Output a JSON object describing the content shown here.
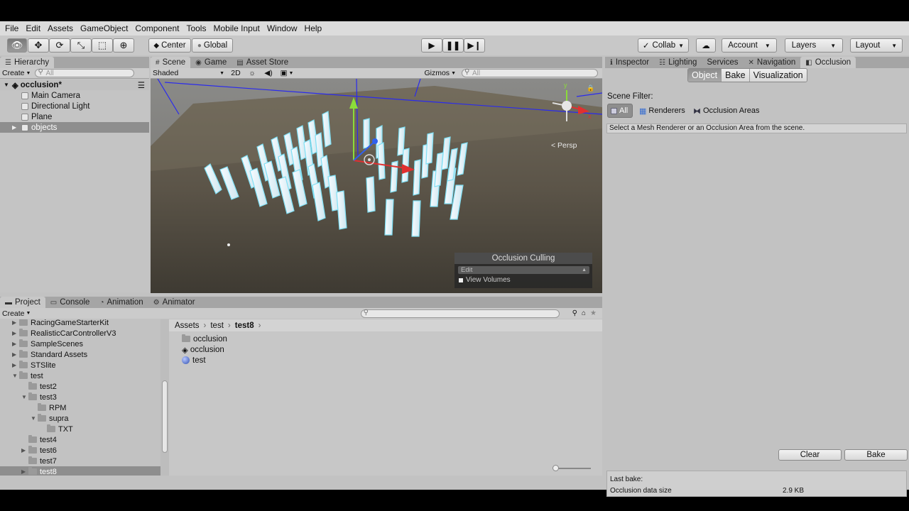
{
  "menu": [
    "File",
    "Edit",
    "Assets",
    "GameObject",
    "Component",
    "Tools",
    "Mobile Input",
    "Window",
    "Help"
  ],
  "toolbar": {
    "pivot_center": "Center",
    "pivot_global": "Global",
    "collab": "Collab",
    "account": "Account",
    "layers": "Layers",
    "layout": "Layout"
  },
  "hierarchy": {
    "tab": "Hierarchy",
    "create": "Create",
    "search_placeholder": "All",
    "scene_name": "occlusion*",
    "items": [
      "Main Camera",
      "Directional Light",
      "Plane",
      "objects"
    ]
  },
  "scene": {
    "tabs": [
      "Scene",
      "Game",
      "Asset Store"
    ],
    "shading": "Shaded",
    "mode_2d": "2D",
    "gizmos": "Gizmos",
    "search_placeholder": "All",
    "persp": "< Persp",
    "occlusion_overlay": {
      "title": "Occlusion Culling",
      "mode": "Edit",
      "view_volumes": "View Volumes"
    }
  },
  "project": {
    "tabs": [
      "Project",
      "Console",
      "Animation",
      "Animator"
    ],
    "create": "Create",
    "tree": [
      {
        "label": "RacingGameStarterKit",
        "depth": 0,
        "arrow": "▶"
      },
      {
        "label": "RealisticCarControllerV3",
        "depth": 0,
        "arrow": "▶"
      },
      {
        "label": "SampleScenes",
        "depth": 0,
        "arrow": "▶"
      },
      {
        "label": "Standard Assets",
        "depth": 0,
        "arrow": "▶"
      },
      {
        "label": "STSlite",
        "depth": 0,
        "arrow": "▶"
      },
      {
        "label": "test",
        "depth": 0,
        "arrow": "▼"
      },
      {
        "label": "test2",
        "depth": 1,
        "arrow": ""
      },
      {
        "label": "test3",
        "depth": 1,
        "arrow": "▼"
      },
      {
        "label": "RPM",
        "depth": 2,
        "arrow": ""
      },
      {
        "label": "supra",
        "depth": 2,
        "arrow": "▼"
      },
      {
        "label": "TXT",
        "depth": 3,
        "arrow": ""
      },
      {
        "label": "test4",
        "depth": 1,
        "arrow": ""
      },
      {
        "label": "test6",
        "depth": 1,
        "arrow": "▶"
      },
      {
        "label": "test7",
        "depth": 1,
        "arrow": ""
      },
      {
        "label": "test8",
        "depth": 1,
        "arrow": "▶"
      }
    ],
    "breadcrumb": [
      "Assets",
      "test",
      "test8"
    ],
    "files": [
      {
        "label": "occlusion",
        "icon": "folder-icon"
      },
      {
        "label": "occlusion",
        "icon": "unity-scene-icon"
      },
      {
        "label": "test",
        "icon": "material-sphere-icon"
      }
    ]
  },
  "inspector": {
    "tabs": [
      "Inspector",
      "Lighting",
      "Services",
      "Navigation",
      "Occlusion"
    ],
    "modes": [
      "Object",
      "Bake",
      "Visualization"
    ],
    "scene_filter_label": "Scene Filter:",
    "filters": [
      "All",
      "Renderers",
      "Occlusion Areas"
    ],
    "hint": "Select a Mesh Renderer or an Occlusion Area from the scene.",
    "clear_label": "Clear",
    "bake_label": "Bake",
    "last_bake_label": "Last bake:",
    "data_size_label": "Occlusion data size",
    "data_size_value": "2.9 KB"
  }
}
